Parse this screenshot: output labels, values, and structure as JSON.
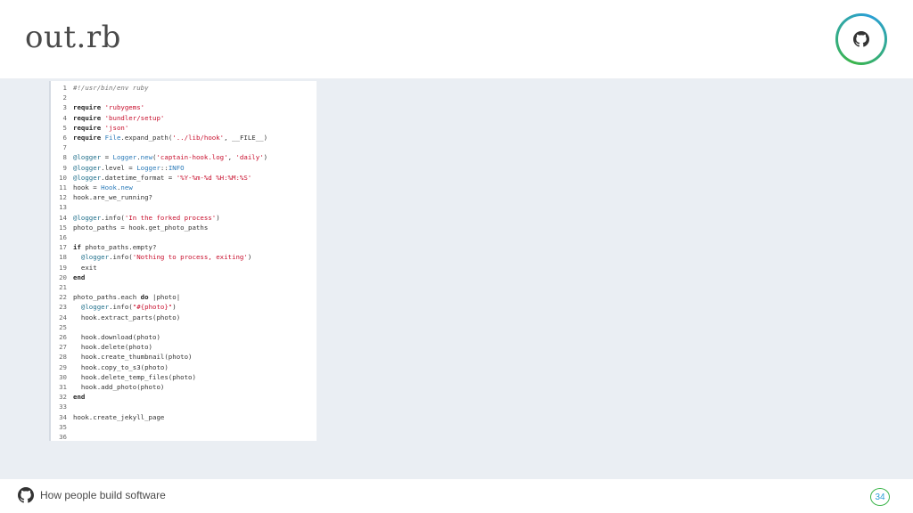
{
  "slide": {
    "title": "out.rb",
    "footer_text": "How people build software",
    "page_number": "34",
    "icons": {
      "header": "github-octocat-icon",
      "footer": "github-octocat-icon"
    },
    "colors": {
      "accent_green": "#3bb54a",
      "accent_blue": "#2a9fd6",
      "content_bg": "#eaeef3"
    }
  },
  "code": {
    "lines": [
      {
        "n": "1",
        "tokens": [
          {
            "t": "#!/usr/bin/env ruby",
            "c": "cm"
          }
        ]
      },
      {
        "n": "2",
        "tokens": []
      },
      {
        "n": "3",
        "tokens": [
          {
            "t": "require",
            "c": "kw"
          },
          {
            "t": " "
          },
          {
            "t": "'rubygems'",
            "c": "str"
          }
        ]
      },
      {
        "n": "4",
        "tokens": [
          {
            "t": "require",
            "c": "kw"
          },
          {
            "t": " "
          },
          {
            "t": "'bundler/setup'",
            "c": "str"
          }
        ]
      },
      {
        "n": "5",
        "tokens": [
          {
            "t": "require",
            "c": "kw"
          },
          {
            "t": " "
          },
          {
            "t": "'json'",
            "c": "str"
          }
        ]
      },
      {
        "n": "6",
        "tokens": [
          {
            "t": "require",
            "c": "kw"
          },
          {
            "t": " "
          },
          {
            "t": "File",
            "c": "const"
          },
          {
            "t": ".expand_path("
          },
          {
            "t": "'../lib/hook'",
            "c": "str"
          },
          {
            "t": ", __FILE__)"
          }
        ]
      },
      {
        "n": "7",
        "tokens": []
      },
      {
        "n": "8",
        "tokens": [
          {
            "t": "@logger",
            "c": "ivar"
          },
          {
            "t": " = "
          },
          {
            "t": "Logger",
            "c": "const"
          },
          {
            "t": "."
          },
          {
            "t": "new",
            "c": "const"
          },
          {
            "t": "("
          },
          {
            "t": "'captain-hook.log'",
            "c": "str"
          },
          {
            "t": ", "
          },
          {
            "t": "'daily'",
            "c": "str"
          },
          {
            "t": ")"
          }
        ]
      },
      {
        "n": "9",
        "tokens": [
          {
            "t": "@logger",
            "c": "ivar"
          },
          {
            "t": ".level = "
          },
          {
            "t": "Logger",
            "c": "const"
          },
          {
            "t": "::"
          },
          {
            "t": "INFO",
            "c": "const"
          }
        ]
      },
      {
        "n": "10",
        "tokens": [
          {
            "t": "@logger",
            "c": "ivar"
          },
          {
            "t": ".datetime_format = "
          },
          {
            "t": "'%Y-%m-%d %H:%M:%S'",
            "c": "str"
          }
        ]
      },
      {
        "n": "11",
        "tokens": [
          {
            "t": "hook = "
          },
          {
            "t": "Hook",
            "c": "const"
          },
          {
            "t": "."
          },
          {
            "t": "new",
            "c": "const"
          }
        ]
      },
      {
        "n": "12",
        "tokens": [
          {
            "t": "hook.are_we_running?"
          }
        ]
      },
      {
        "n": "13",
        "tokens": []
      },
      {
        "n": "14",
        "tokens": [
          {
            "t": "@logger",
            "c": "ivar"
          },
          {
            "t": ".info("
          },
          {
            "t": "'In the forked process'",
            "c": "str"
          },
          {
            "t": ")"
          }
        ]
      },
      {
        "n": "15",
        "tokens": [
          {
            "t": "photo_paths = hook.get_photo_paths"
          }
        ]
      },
      {
        "n": "16",
        "tokens": []
      },
      {
        "n": "17",
        "tokens": [
          {
            "t": "if",
            "c": "kw"
          },
          {
            "t": " photo_paths.empty?"
          }
        ]
      },
      {
        "n": "18",
        "tokens": [
          {
            "t": "  "
          },
          {
            "t": "@logger",
            "c": "ivar"
          },
          {
            "t": ".info("
          },
          {
            "t": "'Nothing to process, exiting'",
            "c": "str"
          },
          {
            "t": ")"
          }
        ]
      },
      {
        "n": "19",
        "tokens": [
          {
            "t": "  exit"
          }
        ]
      },
      {
        "n": "20",
        "tokens": [
          {
            "t": "end",
            "c": "kw"
          }
        ]
      },
      {
        "n": "21",
        "tokens": []
      },
      {
        "n": "22",
        "tokens": [
          {
            "t": "photo_paths.each "
          },
          {
            "t": "do",
            "c": "kw"
          },
          {
            "t": " |photo|"
          }
        ]
      },
      {
        "n": "23",
        "tokens": [
          {
            "t": "  "
          },
          {
            "t": "@logger",
            "c": "ivar"
          },
          {
            "t": ".info("
          },
          {
            "t": "\"#{photo}\"",
            "c": "str"
          },
          {
            "t": ")"
          }
        ]
      },
      {
        "n": "24",
        "tokens": [
          {
            "t": "  hook.extract_parts(photo)"
          }
        ]
      },
      {
        "n": "25",
        "tokens": []
      },
      {
        "n": "26",
        "tokens": [
          {
            "t": "  hook.download(photo)"
          }
        ]
      },
      {
        "n": "27",
        "tokens": [
          {
            "t": "  hook.delete(photo)"
          }
        ]
      },
      {
        "n": "28",
        "tokens": [
          {
            "t": "  hook.create_thumbnail(photo)"
          }
        ]
      },
      {
        "n": "29",
        "tokens": [
          {
            "t": "  hook.copy_to_s3(photo)"
          }
        ]
      },
      {
        "n": "30",
        "tokens": [
          {
            "t": "  hook.delete_temp_files(photo)"
          }
        ]
      },
      {
        "n": "31",
        "tokens": [
          {
            "t": "  hook.add_photo(photo)"
          }
        ]
      },
      {
        "n": "32",
        "tokens": [
          {
            "t": "end",
            "c": "kw"
          }
        ]
      },
      {
        "n": "33",
        "tokens": []
      },
      {
        "n": "34",
        "tokens": [
          {
            "t": "hook.create_jekyll_page"
          }
        ]
      },
      {
        "n": "35",
        "tokens": []
      },
      {
        "n": "36",
        "tokens": []
      }
    ]
  }
}
